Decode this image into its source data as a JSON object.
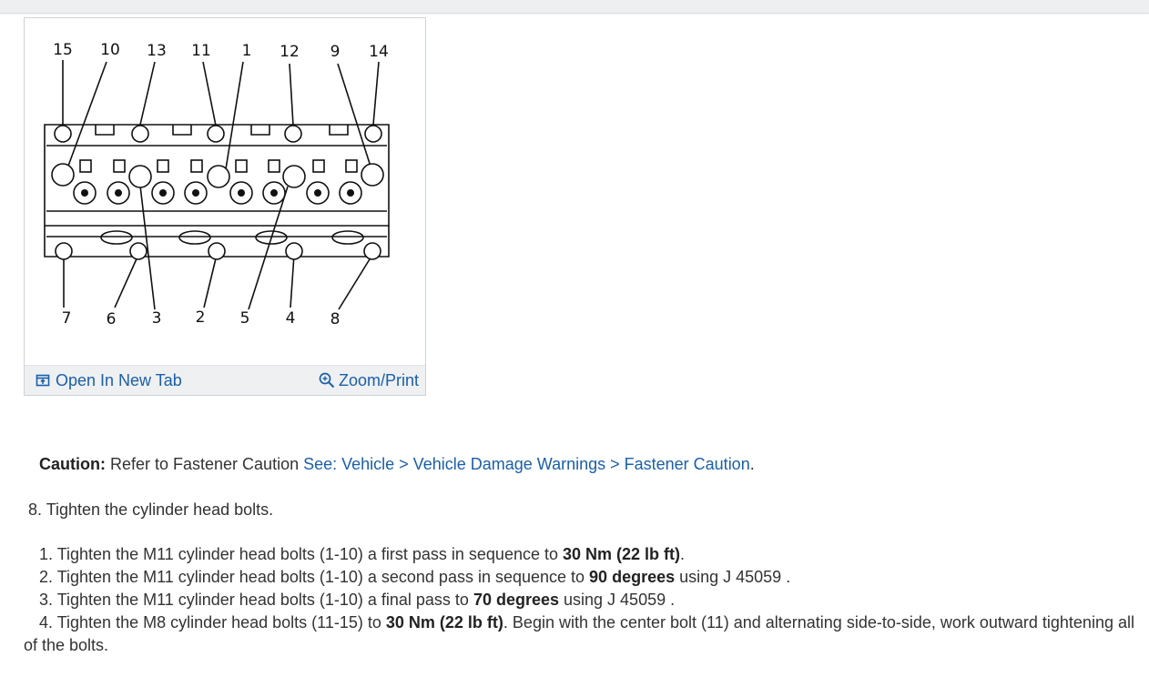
{
  "figure": {
    "top_labels": [
      "15",
      "10",
      "13",
      "11",
      "1",
      "12",
      "9",
      "14"
    ],
    "bottom_labels": [
      "7",
      "6",
      "3",
      "2",
      "5",
      "4",
      "8"
    ],
    "open_tab_label": "Open In New Tab",
    "zoom_print_label": "Zoom/Print",
    "icons": [
      "open-in-new-tab-icon",
      "zoom-in-icon"
    ],
    "link_color": "#1b5fa8"
  },
  "caution": {
    "label": "Caution:",
    "text": " Refer to Fastener Caution ",
    "link": "See: Vehicle > Vehicle Damage Warnings > Fastener Caution",
    "end": "."
  },
  "step8": {
    "text": "8. Tighten the cylinder head bolts."
  },
  "substeps": [
    {
      "num": "1.",
      "pre": " Tighten the M11 cylinder head bolts (1-10) a first pass in sequence to ",
      "bold": "30 Nm (22 lb ft)",
      "post": "."
    },
    {
      "num": "2.",
      "pre": " Tighten the M11 cylinder head bolts (1-10) a second pass in sequence to ",
      "bold": "90 degrees",
      "post": " using J 45059 ."
    },
    {
      "num": "3.",
      "pre": " Tighten the M11 cylinder head bolts (1-10) a final pass to ",
      "bold": "70 degrees",
      "post": " using J 45059 ."
    },
    {
      "num": "4.",
      "pre": " Tighten the M8 cylinder head bolts (11-15) to ",
      "bold": "30 Nm (22 lb ft)",
      "post": ". Begin with the center bolt (11) and alternating side-to-side, work outward tightening all of the bolts."
    }
  ]
}
